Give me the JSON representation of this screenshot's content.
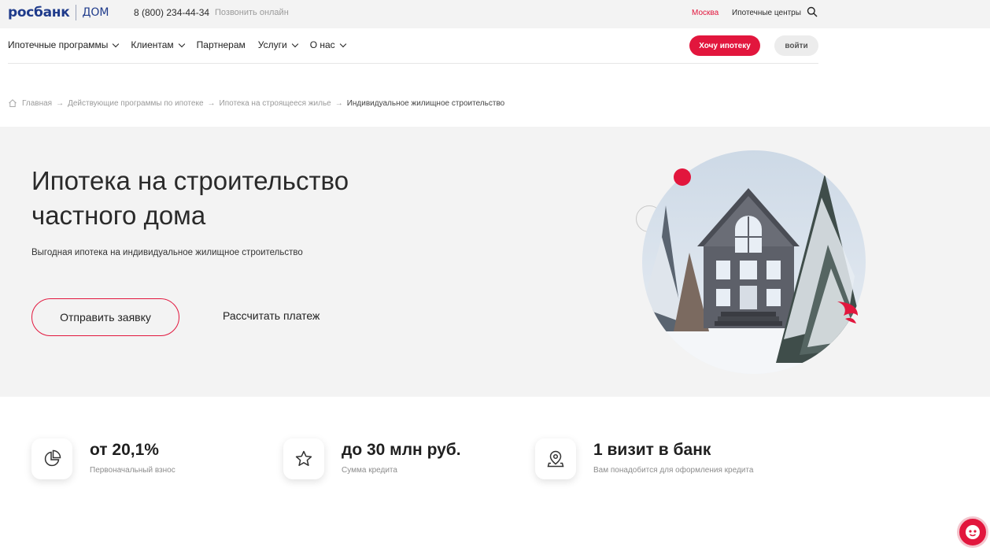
{
  "topbar": {
    "logo": "росбанк",
    "logo_suffix": "ДОМ",
    "phone": "8 (800) 234-44-34",
    "call_online": "Позвонить онлайн",
    "city": "Москва",
    "centers": "Ипотечные центры"
  },
  "nav": {
    "items": [
      {
        "label": "Ипотечные программы",
        "dropdown": true
      },
      {
        "label": "Клиентам",
        "dropdown": true
      },
      {
        "label": "Партнерам",
        "dropdown": false
      },
      {
        "label": "Услуги",
        "dropdown": true
      },
      {
        "label": "О нас",
        "dropdown": true
      }
    ],
    "cta_label": "Хочу ипотеку",
    "login_label": "войти"
  },
  "breadcrumb": [
    "Главная",
    "Действующие программы по ипотеке",
    "Ипотека на строящееся жилье",
    "Индивидуальное жилищное строительство"
  ],
  "hero": {
    "title_line1": "Ипотека на строительство",
    "title_line2": "частного дома",
    "subtitle": "Выгодная ипотека на индивидуальное жилищное строительство",
    "apply_label": "Отправить заявку",
    "calc_label": "Рассчитать платеж"
  },
  "features": [
    {
      "icon": "pie-chart-icon",
      "title": "от 20,1%",
      "subtitle": "Первоначальный взнос"
    },
    {
      "icon": "star-icon",
      "title": "до 30 млн руб.",
      "subtitle": "Сумма кредита"
    },
    {
      "icon": "location-pin-icon",
      "title": "1 визит в банк",
      "subtitle": "Вам понадобится для оформления кредита"
    }
  ],
  "colors": {
    "accent": "#e2163d",
    "brand_blue": "#1f3b8b",
    "hero_bg": "#f3f3f3"
  }
}
